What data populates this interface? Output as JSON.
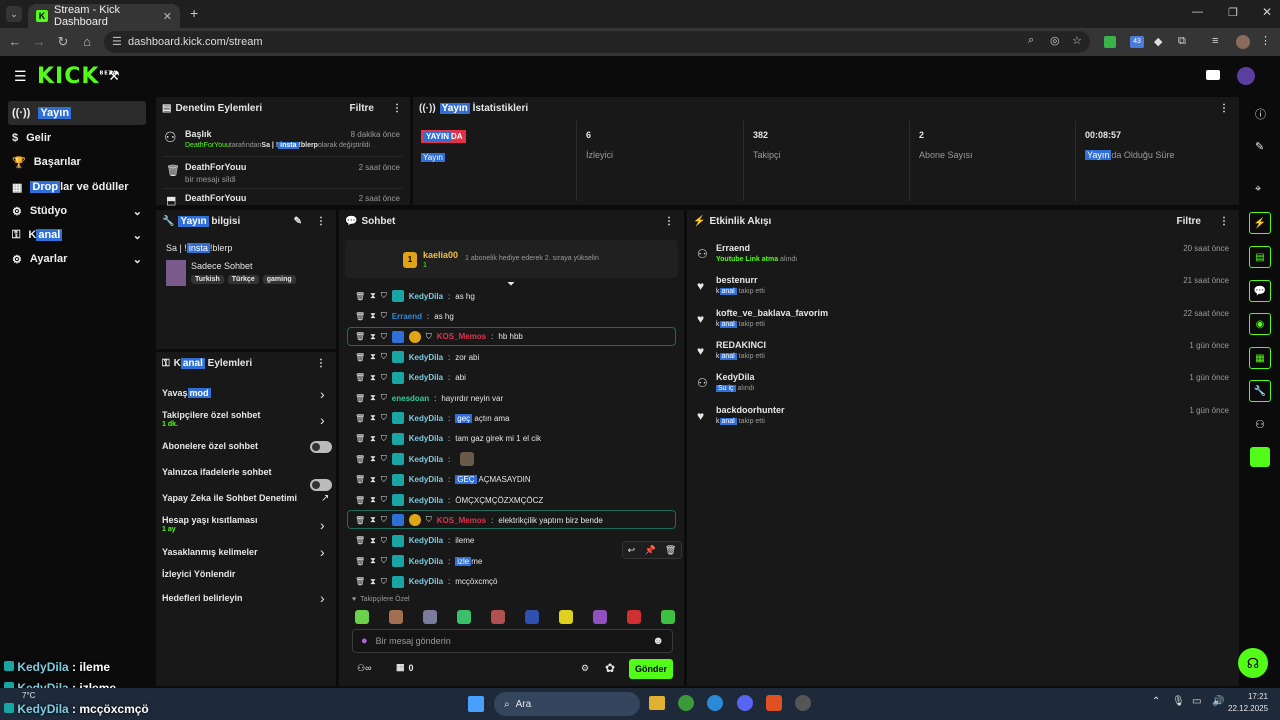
{
  "browser": {
    "tab_title": "Stream - Kick Dashboard",
    "url": "dashboard.kick.com/stream",
    "new_tab": "+",
    "ext_badge": "43"
  },
  "app": {
    "logo": "KICK",
    "beta": "BETA"
  },
  "sidebar": {
    "items": [
      {
        "icon": "broadcast-icon",
        "pre": "",
        "hl": "Yayın",
        "post": ""
      },
      {
        "icon": "dollar-icon",
        "pre": "Gelir",
        "hl": "",
        "post": ""
      },
      {
        "icon": "trophy-icon",
        "pre": "Başarılar",
        "hl": "",
        "post": ""
      },
      {
        "icon": "gift-icon",
        "pre": "",
        "hl": "Drop",
        "post": "lar ve ödüller"
      },
      {
        "icon": "gear-icon",
        "pre": "Stüdyo",
        "hl": "",
        "post": ""
      },
      {
        "icon": "key-icon",
        "pre": "K",
        "hl": "anal",
        "post": ""
      },
      {
        "icon": "settings-icon",
        "pre": "Ayarlar",
        "hl": "",
        "post": ""
      }
    ]
  },
  "moderation": {
    "title": "Denetim Eylemleri",
    "filter": "Filtre",
    "entries": [
      {
        "title": "Başlık",
        "time": "8 dakika önce",
        "actor": "DeathForYouu",
        "mid": " tarafından ",
        "val1": "Sa | !",
        "val_hl": "insta",
        "val2": " !blerp",
        "tail": " olarak değiştirildi"
      },
      {
        "title": "DeathForYouu",
        "time": "2 saat önce",
        "sub": "bir mesajı sildi"
      },
      {
        "title": "DeathForYouu",
        "time": "2 saat önce"
      }
    ]
  },
  "stats": {
    "title_hl": "Yayın",
    "title_rest": " İstatistikleri",
    "status_hl": "YAYIN",
    "status_rest": "DA",
    "status_sub": "Yayın",
    "cards": [
      {
        "value": "6",
        "label": "İzleyici"
      },
      {
        "value": "382",
        "label": "Takipçi"
      },
      {
        "value": "2",
        "label": "Abone Sayısı"
      },
      {
        "value": "00:08:57",
        "label_hl": "Yayın",
        "label": "da Olduğu Süre"
      }
    ]
  },
  "info": {
    "title_hl": "Yayın",
    "title_rest": " bilgisi",
    "stream_title_pre": "Sa | !",
    "stream_title_hl": "insta",
    "stream_title_post": " !blerp",
    "category": "Sadece Sohbet",
    "tags": [
      "Turkish",
      "Türkçe",
      "gaming"
    ]
  },
  "channel_actions": {
    "title_pre": "K",
    "title_hl": "anal",
    "title_rest": " Eylemleri",
    "items": [
      {
        "pre": "Yavaş ",
        "hl": "mod",
        "sub": "",
        "control": "chevron"
      },
      {
        "pre": "Takipçilere özel sohbet",
        "hl": "",
        "sub": "1 dk.",
        "control": "chevron"
      },
      {
        "pre": "Abonelere özel sohbet",
        "hl": "",
        "sub": "",
        "control": "toggle"
      },
      {
        "pre": "Yalnızca ifadelerle sohbet",
        "hl": "",
        "sub": "",
        "control": "toggle"
      },
      {
        "pre": "Yapay Zeka ile Sohbet Denetimi",
        "hl": "",
        "sub": "",
        "control": "external"
      },
      {
        "pre": "Hesap yaşı kısıtlaması",
        "hl": "",
        "sub": "1 ay",
        "control": "chevron"
      },
      {
        "pre": "Yasaklanmış kelimeler",
        "hl": "",
        "sub": "",
        "control": "chevron"
      },
      {
        "pre": "İzleyici Yönlendir",
        "hl": "",
        "sub": "",
        "control": ""
      },
      {
        "pre": "Hedefleri belirleyin",
        "hl": "",
        "sub": "",
        "control": "chevron"
      }
    ]
  },
  "chat": {
    "title": "Sohbet",
    "gifter": "kaelia00",
    "gifter_count": "1",
    "gifter_msg": "1 abonelik hediye ederek 2. sıraya yükselin",
    "messages": [
      {
        "user": "KedyDila",
        "pre": "as hg",
        "hl": "",
        "post": "",
        "style": "normal"
      },
      {
        "user": "Erraend",
        "pre": "as hg",
        "hl": "",
        "post": "",
        "style": "blue"
      },
      {
        "user": "KOS_Memos",
        "pre": "hb hbb",
        "hl": "",
        "post": "",
        "style": "red"
      },
      {
        "user": "KedyDila",
        "pre": "zor abi",
        "hl": "",
        "post": "",
        "style": "normal"
      },
      {
        "user": "KedyDila",
        "pre": "abi",
        "hl": "",
        "post": "",
        "style": "normal"
      },
      {
        "user": "enesdoan",
        "pre": "hayırdır neyin var",
        "hl": "",
        "post": "",
        "style": "teal"
      },
      {
        "user": "KedyDila",
        "pre": "",
        "hl": "geç",
        "post": " açtın ama",
        "style": "normal"
      },
      {
        "user": "KedyDila",
        "pre": "tam gaz girek mi 1 el cik",
        "hl": "",
        "post": "",
        "style": "normal"
      },
      {
        "user": "KedyDila",
        "pre": "",
        "hl": "",
        "post": "",
        "style": "emote"
      },
      {
        "user": "KedyDila",
        "pre": "",
        "hl": "GEÇ",
        "post": " AÇMASAYDIN",
        "style": "normal"
      },
      {
        "user": "KedyDila",
        "pre": "ÖMÇXÇMÇÖZXMÇÖCZ",
        "hl": "",
        "post": "",
        "style": "normal"
      },
      {
        "user": "KOS_Memos",
        "pre": "elektrikçilik yaptım birz bende",
        "hl": "",
        "post": "",
        "style": "red"
      },
      {
        "user": "KedyDila",
        "pre": "ileme",
        "hl": "",
        "post": "",
        "style": "normal"
      },
      {
        "user": "KedyDila",
        "pre": "",
        "hl": "izle",
        "post": "me",
        "style": "normal"
      },
      {
        "user": "KedyDila",
        "pre": "mcçöxcmçö",
        "hl": "",
        "post": "",
        "style": "normal"
      }
    ],
    "followers_label": "Takipçilere Özel",
    "input_placeholder": "Bir mesaj gönderin",
    "points": "0",
    "send": "Gönder"
  },
  "activity": {
    "title": "Etkinlik Akışı",
    "filter": "Filtre",
    "items": [
      {
        "icon": "user-icon",
        "name": "Erraend",
        "sub_pre": "",
        "sub_hl": "",
        "sub_green": "Youtube Link atma",
        "sub_post": " alındı",
        "time": "20 saat önce"
      },
      {
        "icon": "heart-icon",
        "name": "bestenurr",
        "sub_pre": "k",
        "sub_hl": "anal",
        "sub_green": "",
        "sub_post": " takip etti",
        "time": "21 saat önce"
      },
      {
        "icon": "heart-icon",
        "name": "kofte_ve_baklava_favorim",
        "sub_pre": "k",
        "sub_hl": "anal",
        "sub_green": "",
        "sub_post": " takip etti",
        "time": "22 saat önce"
      },
      {
        "icon": "heart-icon",
        "name": "REDAKINCI",
        "sub_pre": "k",
        "sub_hl": "anal",
        "sub_green": "",
        "sub_post": " takip etti",
        "time": "1 gün önce"
      },
      {
        "icon": "user-icon",
        "name": "KedyDila",
        "sub_pre": "",
        "sub_hl": "Su iç",
        "sub_green": "",
        "sub_post": " alındı",
        "time": "1 gün önce"
      },
      {
        "icon": "heart-icon",
        "name": "backdoorhunter",
        "sub_pre": "k",
        "sub_hl": "anal",
        "sub_green": "",
        "sub_post": " takip etti",
        "time": "1 gün önce"
      }
    ]
  },
  "overlay": [
    {
      "user": "KedyDila",
      "text": "ileme"
    },
    {
      "user": "KedyDila",
      "text": "izleme"
    },
    {
      "user": "KedyDila",
      "text": "mcçöxcmçö"
    }
  ],
  "taskbar": {
    "search": "Ara",
    "temp": "7°C",
    "time": "17:21",
    "date": "22.12.2025"
  },
  "colors": {
    "accent": "#53fc18",
    "highlight": "#2f6fd6",
    "live": "#e0324a"
  }
}
